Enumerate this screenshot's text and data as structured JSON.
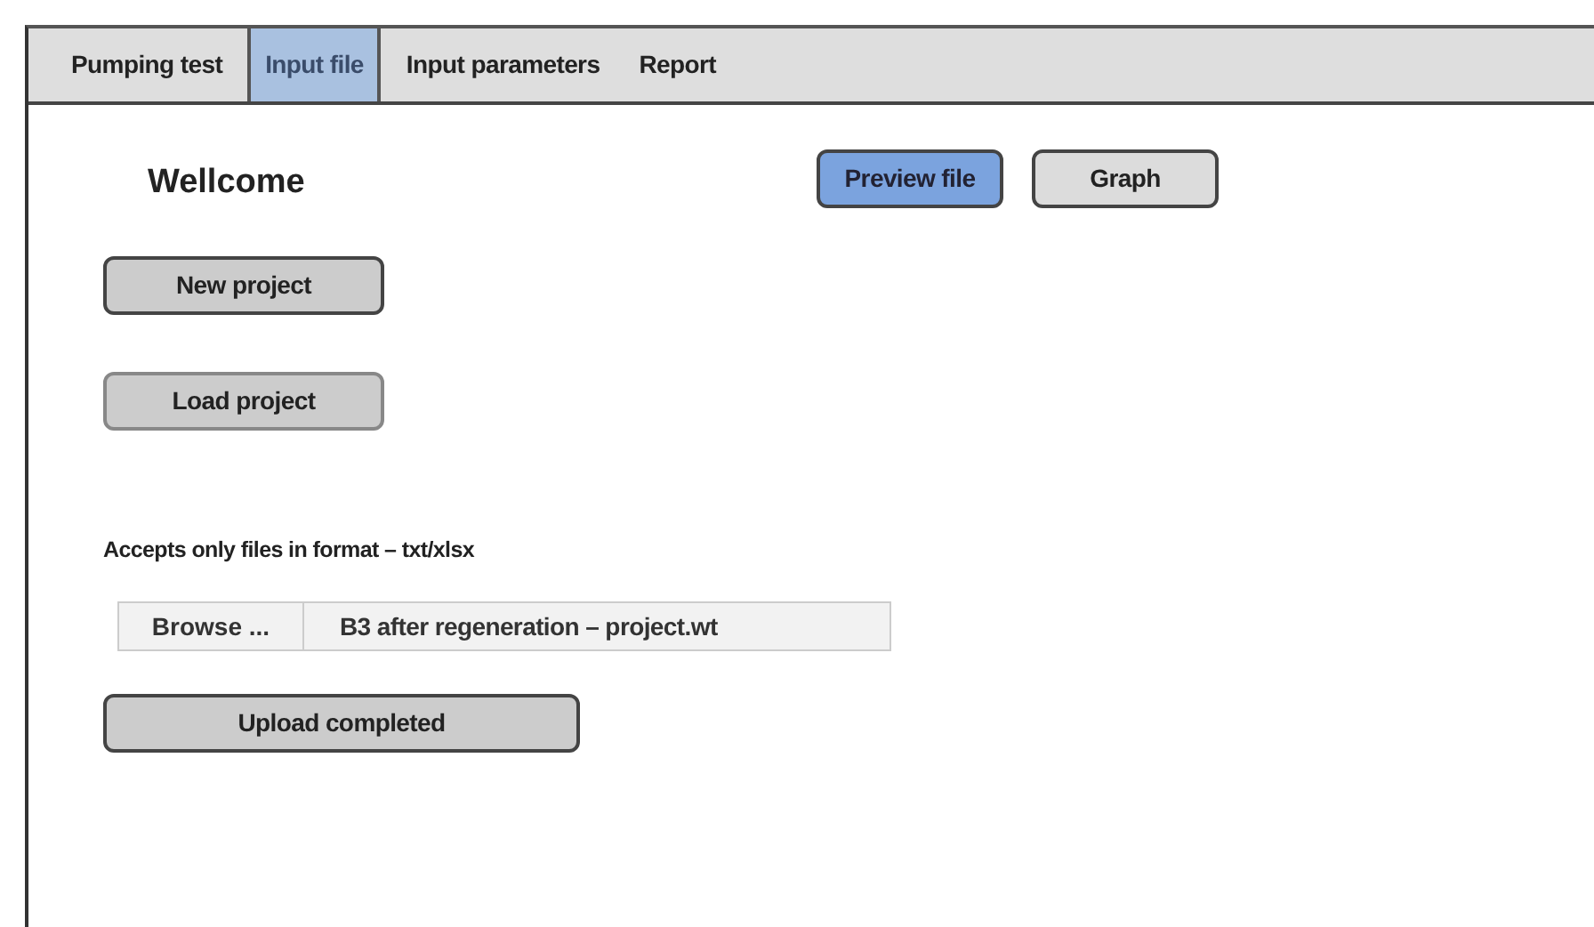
{
  "tabs": [
    {
      "label": "Pumping test",
      "selected": false
    },
    {
      "label": "Input file",
      "selected": true
    },
    {
      "label": "Input parameters",
      "selected": false
    },
    {
      "label": "Report",
      "selected": false
    }
  ],
  "heading": "Wellcome",
  "view_buttons": [
    {
      "label": "Preview file",
      "selected": true
    },
    {
      "label": "Graph",
      "selected": false
    }
  ],
  "project_buttons": [
    "New project",
    "Load project"
  ],
  "format_note": "Accepts only files in format – txt/xlsx",
  "file_picker": {
    "button": "Browse ...",
    "value": "B3 after regeneration – project.wt"
  },
  "status_button": "Upload completed"
}
